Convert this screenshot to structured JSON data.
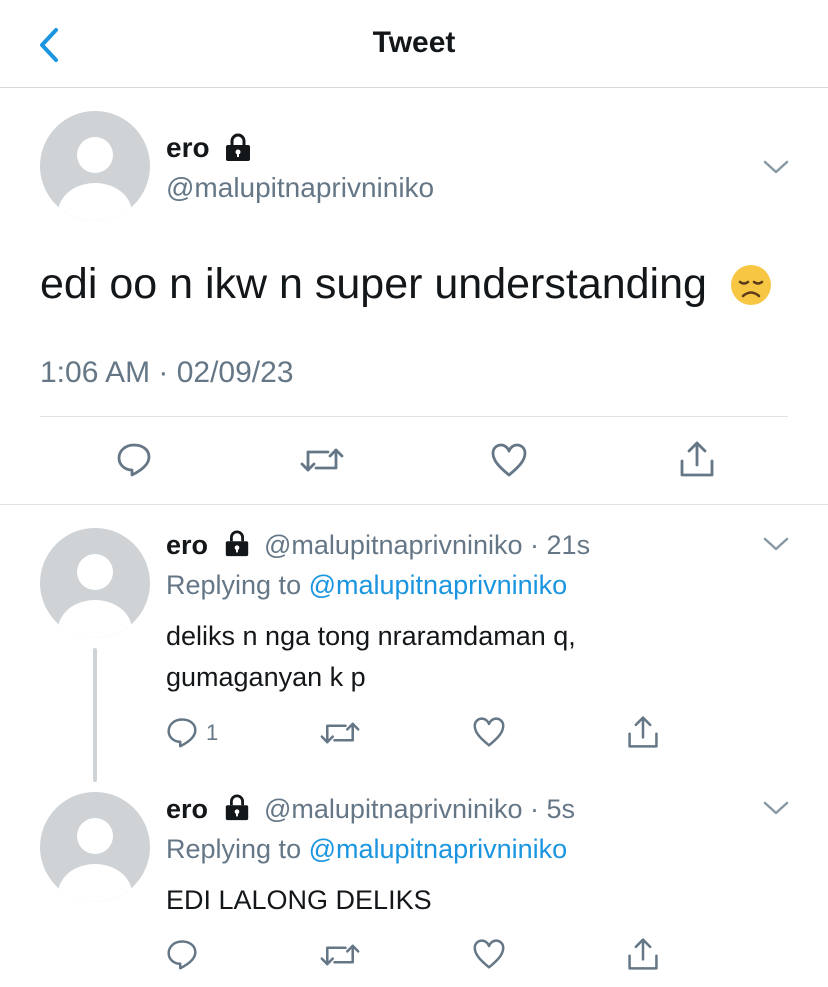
{
  "header": {
    "title": "Tweet"
  },
  "tweet": {
    "name": "ero",
    "handle": "@malupitnaprivniniko",
    "text": "edi oo n ikw n super understanding",
    "emoji": "disappointed-face",
    "timestamp": "1:06 AM · 02/09/23"
  },
  "replies": [
    {
      "name": "ero",
      "handle": "@malupitnaprivniniko",
      "time": "· 21s",
      "replying_prefix": "Replying to",
      "replying_to": "@malupitnaprivniniko",
      "text_line1": "deliks n nga tong nraramdaman q,",
      "text_line2": "gumaganyan k p",
      "reply_count": "1"
    },
    {
      "name": "ero",
      "handle": "@malupitnaprivniniko",
      "time": "· 5s",
      "replying_prefix": "Replying to",
      "replying_to": "@malupitnaprivniniko",
      "text_line1": "EDI LALONG DELIKS"
    }
  ],
  "colors": {
    "accent": "#1b95e0",
    "secondary_text": "#657786",
    "icon": "#657786"
  }
}
